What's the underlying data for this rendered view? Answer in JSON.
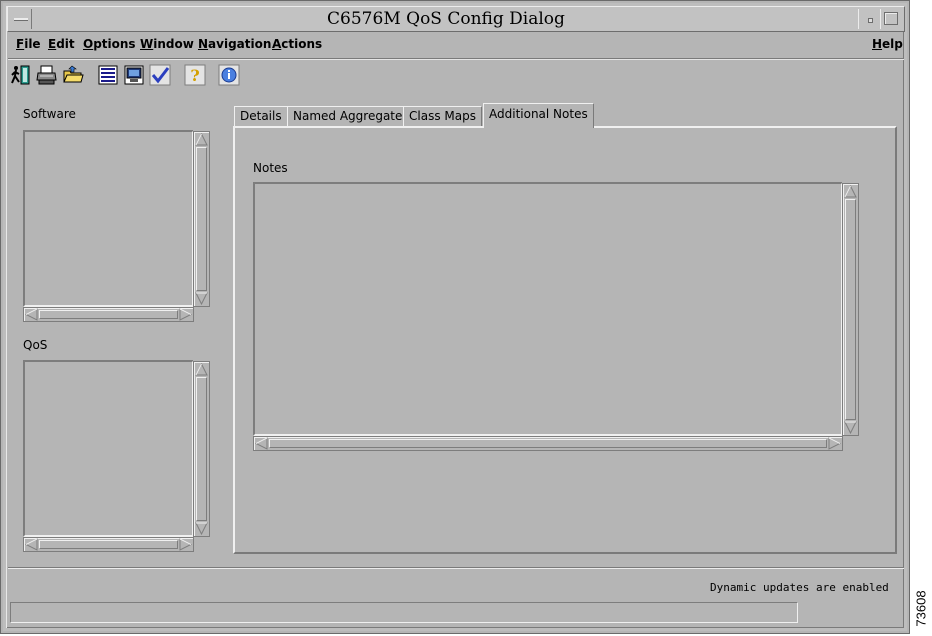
{
  "window": {
    "title": "C6576M QoS Config Dialog"
  },
  "menubar": {
    "left": [
      "File",
      "Edit",
      "Options",
      "Window",
      "Navigation",
      "Actions"
    ],
    "right": "Help"
  },
  "toolbar": {
    "icons": [
      "exit-icon",
      "print-icon",
      "open-folder-icon",
      "list-icon",
      "monitor-icon",
      "checkmark-icon",
      "help-icon",
      "info-icon"
    ]
  },
  "left_panel": {
    "software_label": "Software",
    "qos_label": "QoS"
  },
  "tabs": [
    "Details",
    "Named Aggregate",
    "Class Maps",
    "Additional Notes"
  ],
  "active_tab": "Additional Notes",
  "notes": {
    "label": "Notes",
    "value": ""
  },
  "status": {
    "message": "Dynamic updates are enabled"
  },
  "figure_id": "73608",
  "colors": {
    "background": "#b5b5b5",
    "highlight": "#f0f0f0",
    "shadow": "#7d7d7d"
  }
}
